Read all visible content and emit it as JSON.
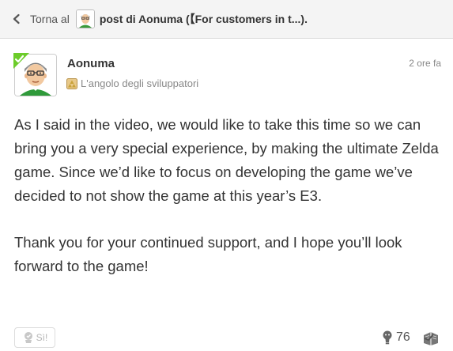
{
  "header": {
    "back_label": "Torna al",
    "post_title": "post di Aonuma (【For customers in t...",
    "title_suffix": ")."
  },
  "post": {
    "author": "Aonuma",
    "timestamp": "2 ore fa",
    "community": "L'angolo degli sviluppatori",
    "paragraphs": [
      "As I said in the video, we would like to take this time so we can bring you a very special experience, by making the ultimate Zelda game. Since we’d like to focus on developing the game we’ve decided to not show the game at this year’s E3.",
      "Thank you for your continued support, and I hope you’ll look forward to the game!"
    ]
  },
  "footer": {
    "yeah_label": "Sì!",
    "empathy_count": "76"
  },
  "icons": {
    "back": "chevron-left-icon",
    "verified": "verified-check-icon",
    "community": "zelda-community-icon",
    "yeah": "yeah-hand-icon",
    "empathy": "empathy-icon",
    "comments": "comment-book-icon"
  },
  "colors": {
    "verified": "#6ccc2a",
    "accent_text": "#333333",
    "muted_text": "#888888"
  }
}
